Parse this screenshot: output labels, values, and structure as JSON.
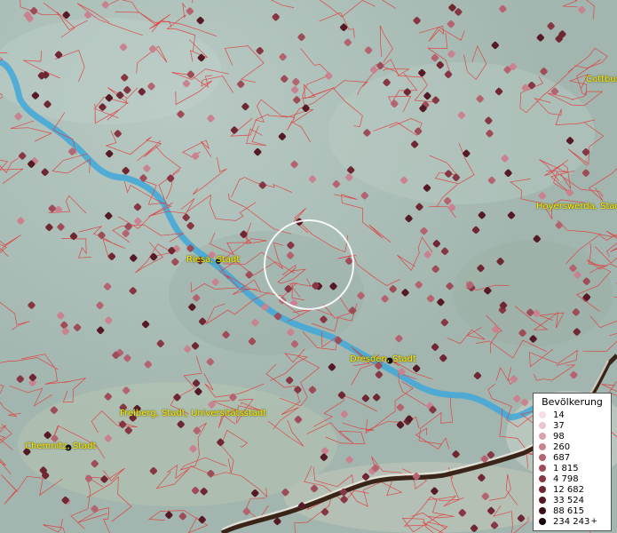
{
  "map": {
    "cities": [
      {
        "id": "riesa",
        "name": "Riesa, Stadt"
      },
      {
        "id": "dresden",
        "name": "Dresden, Stadt"
      },
      {
        "id": "freiberg",
        "name": "Freiberg, Stadt, Universitätsstadt"
      },
      {
        "id": "chemnitz",
        "name": "Chemnitz, Stadt"
      },
      {
        "id": "cottbus",
        "name": "Cottbus"
      },
      {
        "id": "hoyerswerda",
        "name": "Hoyerswerda, Stadt"
      }
    ],
    "colors": {
      "terrain": "#a9bdb6",
      "river": "#3fa8d8",
      "borders": "#e23a3a",
      "label": "#ffee00",
      "focus_circle": "#ffffff",
      "state_border": "#3a2418"
    }
  },
  "legend": {
    "title": "Bevölkerung",
    "items": [
      {
        "label": "14",
        "color": "#f6dde6"
      },
      {
        "label": "37",
        "color": "#ebc3cd"
      },
      {
        "label": "98",
        "color": "#d9a2ae"
      },
      {
        "label": "260",
        "color": "#c98390"
      },
      {
        "label": "687",
        "color": "#b46471"
      },
      {
        "label": "1 815",
        "color": "#9e4c58"
      },
      {
        "label": "4 798",
        "color": "#873744"
      },
      {
        "label": "12 682",
        "color": "#6e2733"
      },
      {
        "label": "33 524",
        "color": "#551a25"
      },
      {
        "label": "88 615",
        "color": "#3b0f17"
      },
      {
        "label": "234 243",
        "color": "#1a0508",
        "plus": "+"
      }
    ]
  }
}
